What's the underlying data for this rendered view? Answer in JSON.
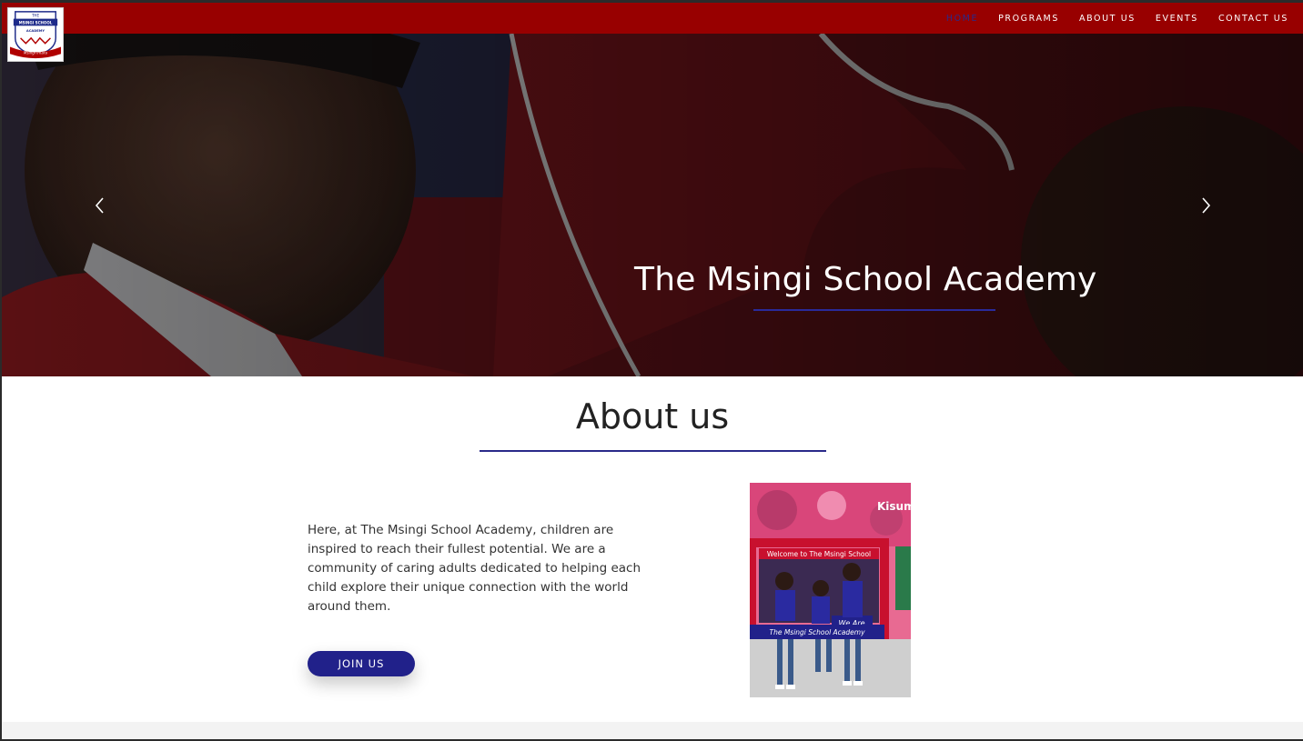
{
  "brand": {
    "logo_alt": "The Msingi School Academy logo",
    "logo_text_top": "THE",
    "logo_text_name": "MSINGI SCHOOL",
    "logo_text_sub": "ACADEMY",
    "logo_motto": "Msingi imara"
  },
  "nav": {
    "items": [
      {
        "label": "HOME",
        "active": true
      },
      {
        "label": "PROGRAMS",
        "active": false
      },
      {
        "label": "ABOUT US",
        "active": false
      },
      {
        "label": "EVENTS",
        "active": false
      },
      {
        "label": "CONTACT US",
        "active": false
      }
    ]
  },
  "hero": {
    "title": "The Msingi School Academy",
    "prev_icon": "chevron-left-icon",
    "next_icon": "chevron-right-icon"
  },
  "about": {
    "heading": "About us",
    "body": "Here, at The Msingi School Academy, children are inspired to reach their fullest potential. We are a community of caring adults dedicated to helping each child explore their unique connection with the world around them.",
    "button_label": "JOIN US",
    "photo_banner_top": "Welcome to The Msingi School",
    "photo_we_are": "We Are",
    "photo_banner_bottom": "The Msingi School Academy",
    "photo_corner_text": "Kisum"
  },
  "colors": {
    "nav_bg": "#980000",
    "accent_blue": "#21218a",
    "text_dark": "#222222"
  }
}
